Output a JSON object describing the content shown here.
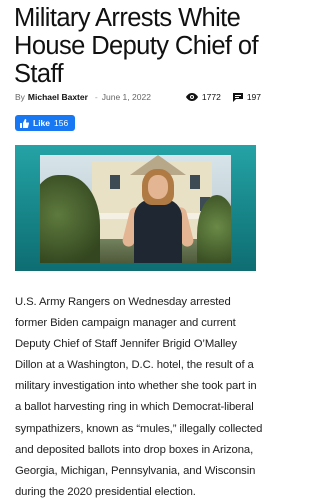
{
  "article": {
    "headline": "Military Arrests White House Deputy Chief of Staff",
    "byline_prefix": "By",
    "author": "Michael Baxter",
    "separator": "-",
    "date": "June 1, 2022",
    "views": "1772",
    "comments": "197",
    "body": "U.S. Army Rangers on Wednesday arrested former Biden campaign manager and current Deputy Chief of Staff Jennifer Brigid O’Malley Dillon at a Washington, D.C. hotel, the result of a military investigation into whether she took part in a ballot harvesting ring in which Democrat-liberal sympathizers, known as “mules,” illegally collected and deposited ballots into drop boxes in Arizona, Georgia, Michigan, Pennsylvania, and Wisconsin during the 2020 presidential election."
  },
  "like_button": {
    "label": "Like",
    "count": "156"
  },
  "icons": {
    "views": "eye-icon",
    "comments": "comment-icon",
    "like": "thumbs-up-icon"
  },
  "colors": {
    "like_button": "#1877f2",
    "hero_frame": "#1a8d90"
  }
}
